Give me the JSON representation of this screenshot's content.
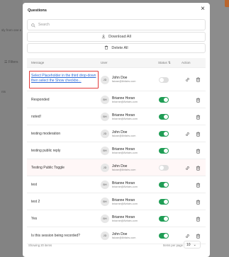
{
  "background": {
    "left_text": "sly from one e",
    "filter_label": "Filters",
    "filter_sub": "nts"
  },
  "modal": {
    "title": "Questions",
    "close_glyph": "×",
    "search_placeholder": "Search",
    "download_label": "Download All",
    "delete_label": "Delete All"
  },
  "table": {
    "headers": {
      "message": "Message",
      "user": "User",
      "status": "Status ⇅",
      "action": "Action"
    },
    "rows": [
      {
        "message": "Select Placeholder in the third drop-down then select the Show checkbo...",
        "initials": "JD",
        "name": "John Doe",
        "email": "faizan@8vfairs.com",
        "status": "off",
        "has_link": true,
        "highlighted": true
      },
      {
        "message": "Responded",
        "initials": "BH",
        "name": "Brianne Horan",
        "email": "brianne@8vfairs.com",
        "status": "on",
        "has_link": false
      },
      {
        "message": "noted!",
        "initials": "BH",
        "name": "Brianne Horan",
        "email": "brianne@8vfairs.com",
        "status": "on",
        "has_link": false
      },
      {
        "message": "testing moderation",
        "initials": "JD",
        "name": "John Doe",
        "email": "faizan@8vfairs.com",
        "status": "on",
        "has_link": true
      },
      {
        "message": "testing public reply",
        "initials": "BH",
        "name": "Brianne Horan",
        "email": "brianne@8vfairs.com",
        "status": "on",
        "has_link": false
      },
      {
        "message": "Testing Public Toggle",
        "initials": "JD",
        "name": "John Doe",
        "email": "faizan@8vfairs.com",
        "status": "off",
        "has_link": true,
        "pink": true
      },
      {
        "message": "test",
        "initials": "BH",
        "name": "Brianne Horan",
        "email": "brianne@8vfairs.com",
        "status": "on",
        "has_link": false
      },
      {
        "message": "test 2",
        "initials": "BH",
        "name": "Brianne Horan",
        "email": "brianne@8vfairs.com",
        "status": "on",
        "has_link": false
      },
      {
        "message": "Yes",
        "initials": "BH",
        "name": "Brianne Horan",
        "email": "brianne@8vfairs.com",
        "status": "on",
        "has_link": false
      },
      {
        "message": "Is this session being recorded?",
        "initials": "JD",
        "name": "John Doe",
        "email": "faizan@8vfairs.com",
        "status": "on",
        "has_link": true
      }
    ]
  },
  "footer": {
    "count": "Showing 20 items",
    "per_page_label": "Items per page",
    "per_page_value": "10",
    "chevron": "⌄"
  },
  "colors": {
    "toggle_on": "#1f9d55",
    "toggle_off": "#dedede",
    "highlight": "#e23b3b",
    "link": "#2d6bd8"
  },
  "icons": {
    "search": "search-icon",
    "download": "download-icon",
    "delete": "trash-icon",
    "row_link": "link-icon",
    "row_delete": "trash-icon",
    "close": "close-icon"
  }
}
